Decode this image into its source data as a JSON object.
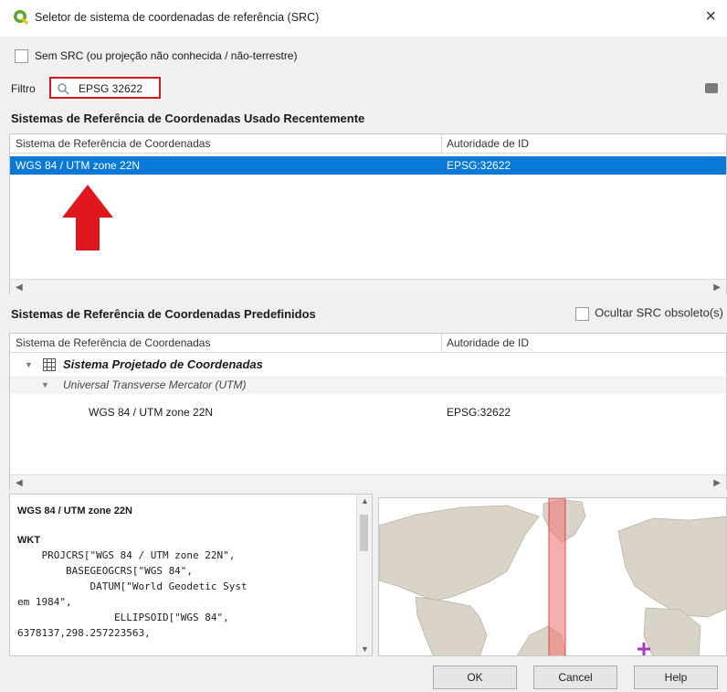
{
  "window": {
    "title": "Seletor de sistema de coordenadas de referência (SRC)",
    "close_glyph": "×"
  },
  "no_crs": {
    "label": "Sem SRC (ou projeção não conhecida / não-terrestre)"
  },
  "filter": {
    "label": "Filtro",
    "value": "EPSG 32622"
  },
  "recent": {
    "title": "Sistemas de Referência de Coordenadas Usado Recentemente",
    "columns": [
      "Sistema de Referência de Coordenadas",
      "Autoridade de ID"
    ],
    "rows": [
      {
        "name": "WGS 84 / UTM zone 22N",
        "authid": "EPSG:32622"
      }
    ]
  },
  "predefined": {
    "title": "Sistemas de Referência de Coordenadas Predefinidos",
    "hide_deprecated_label": "Ocultar SRC obsoleto(s)",
    "columns": [
      "Sistema de Referência de Coordenadas",
      "Autoridade de ID"
    ],
    "group": "Sistema Projetado de Coordenadas",
    "subgroup": "Universal Transverse Mercator (UTM)",
    "item": {
      "name": "WGS 84 / UTM zone 22N",
      "authid": "EPSG:32622"
    }
  },
  "details": {
    "name": "WGS 84 / UTM zone 22N",
    "wkt_label": "WKT",
    "wkt_lines": [
      "    PROJCRS[\"WGS 84 / UTM zone 22N\",",
      "        BASEGEOGCRS[\"WGS 84\",",
      "            DATUM[\"World Geodetic Syst",
      "em 1984\",",
      "                ELLIPSOID[\"WGS 84\",",
      "6378137,298.257223563,"
    ]
  },
  "buttons": {
    "ok": "OK",
    "cancel": "Cancel",
    "help": "Help"
  },
  "colors": {
    "selection": "#0a78d7",
    "highlight": "#d0181e",
    "extent": "#f07a7a"
  },
  "icons": {
    "app": "qgis-icon",
    "search": "search-icon",
    "clear": "clear-icon",
    "arrow": "red-up-arrow"
  }
}
